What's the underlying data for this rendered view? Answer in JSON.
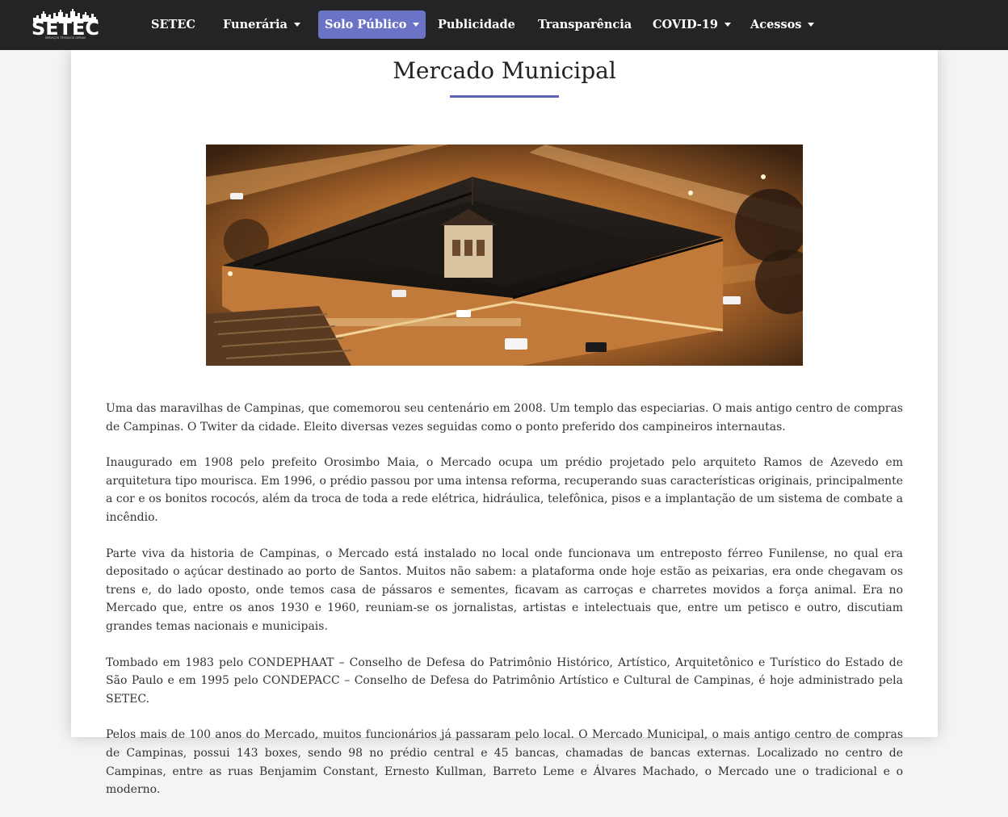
{
  "nav": {
    "logo": {
      "text": "SETEC",
      "subtitle": "SERVIÇOS TÉCNICOS GERAIS"
    },
    "items": [
      {
        "label": "SETEC",
        "dropdown": false,
        "active": false
      },
      {
        "label": "Funerária",
        "dropdown": true,
        "active": false
      },
      {
        "label": "Solo Público",
        "dropdown": true,
        "active": true
      },
      {
        "label": "Publicidade",
        "dropdown": false,
        "active": false
      },
      {
        "label": "Transparência",
        "dropdown": false,
        "active": false
      },
      {
        "label": "COVID-19",
        "dropdown": true,
        "active": false
      },
      {
        "label": "Acessos",
        "dropdown": true,
        "active": false
      }
    ]
  },
  "page": {
    "title": "Mercado Municipal",
    "paragraphs": [
      "Uma das maravilhas de Campinas, que comemorou seu centenário em 2008. Um templo das especiarias. O mais antigo centro de compras de Campinas. O Twiter da cidade. Eleito diversas vezes seguidas como o ponto preferido dos campineiros internautas.",
      "Inaugurado em 1908 pelo prefeito Orosimbo Maia, o Mercado ocupa um prédio projetado pelo arquiteto Ramos de Azevedo em arquitetura tipo mourisca. Em 1996, o prédio passou por uma intensa reforma, recuperando suas características originais, principalmente a cor e os bonitos rococós, além da troca de toda a rede elétrica, hidráulica, telefônica, pisos e a implantação de um sistema de combate a incêndio.",
      "Parte viva da historia de Campinas, o Mercado está instalado no local onde funcionava um entreposto férreo Funilense, no qual era depositado o açúcar destinado ao porto de Santos. Muitos não sabem: a plataforma onde hoje estão as peixarias, era onde chegavam os trens e, do lado oposto, onde temos casa de pássaros e sementes, ficavam as carroças e charretes movidos a força animal. Era no Mercado que, entre os anos 1930 e 1960, reuniam-se os jornalistas, artistas e intelectuais que, entre um petisco e outro, discutiam grandes temas nacionais e municipais.",
      "Tombado em 1983 pelo CONDEPHAAT – Conselho de Defesa do Patrimônio Histórico, Artístico, Arquitetônico e Turístico do Estado de São Paulo e em 1995 pelo CONDEPACC – Conselho de Defesa do Patrimônio Artístico e Cultural de Campinas, é hoje administrado pela SETEC.",
      "Pelos mais de 100 anos do Mercado, muitos funcionários já passaram pelo local. O Mercado Municipal, o mais antigo centro de compras de Campinas, possui 143 boxes, sendo 98 no prédio central e 45 bancas, chamadas de bancas externas. Localizado no centro de Campinas, entre as ruas Benjamim Constant, Ernesto Kullman, Barreto Leme e Álvares Machado, o Mercado une o tradicional e o moderno."
    ]
  },
  "colors": {
    "navbar": "#222426",
    "active_nav": "#6b73c6",
    "title_underline": "#5a63b8",
    "text": "#333333",
    "background": "#f4f4f4"
  }
}
